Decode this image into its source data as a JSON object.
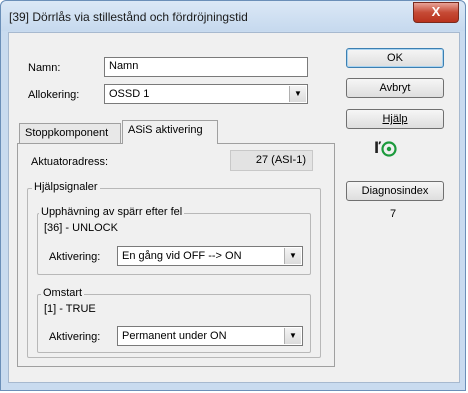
{
  "window": {
    "title": "[39] Dörrlås via stillestånd och fördröjningstid",
    "close_label": "X"
  },
  "fields": {
    "name_label": "Namn:",
    "name_value": "Namn",
    "alloc_label": "Allokering:",
    "alloc_value": "OSSD 1"
  },
  "tabs": [
    {
      "label": "Stoppkomponent"
    },
    {
      "label": "ASiS aktivering"
    }
  ],
  "aktuator": {
    "label": "Aktuatoradress:",
    "value": "27 (ASI-1)"
  },
  "hjalp_group": {
    "label": "Hjälpsignaler",
    "unlock": {
      "label": "Upphävning av spärr efter fel",
      "signal": "[36] - UNLOCK",
      "activation_label": "Aktivering:",
      "activation_value": "En gång vid OFF --> ON"
    },
    "omstart": {
      "label": "Omstart",
      "signal": "[1] - TRUE",
      "activation_label": "Aktivering:",
      "activation_value": "Permanent under ON"
    }
  },
  "buttons": {
    "ok": "OK",
    "cancel": "Avbryt",
    "help": "Hjälp",
    "diag": "Diagnosindex"
  },
  "diag_value": "7",
  "icons": [
    "close-icon",
    "dropdown-arrow-icon",
    "sensor-icon"
  ]
}
